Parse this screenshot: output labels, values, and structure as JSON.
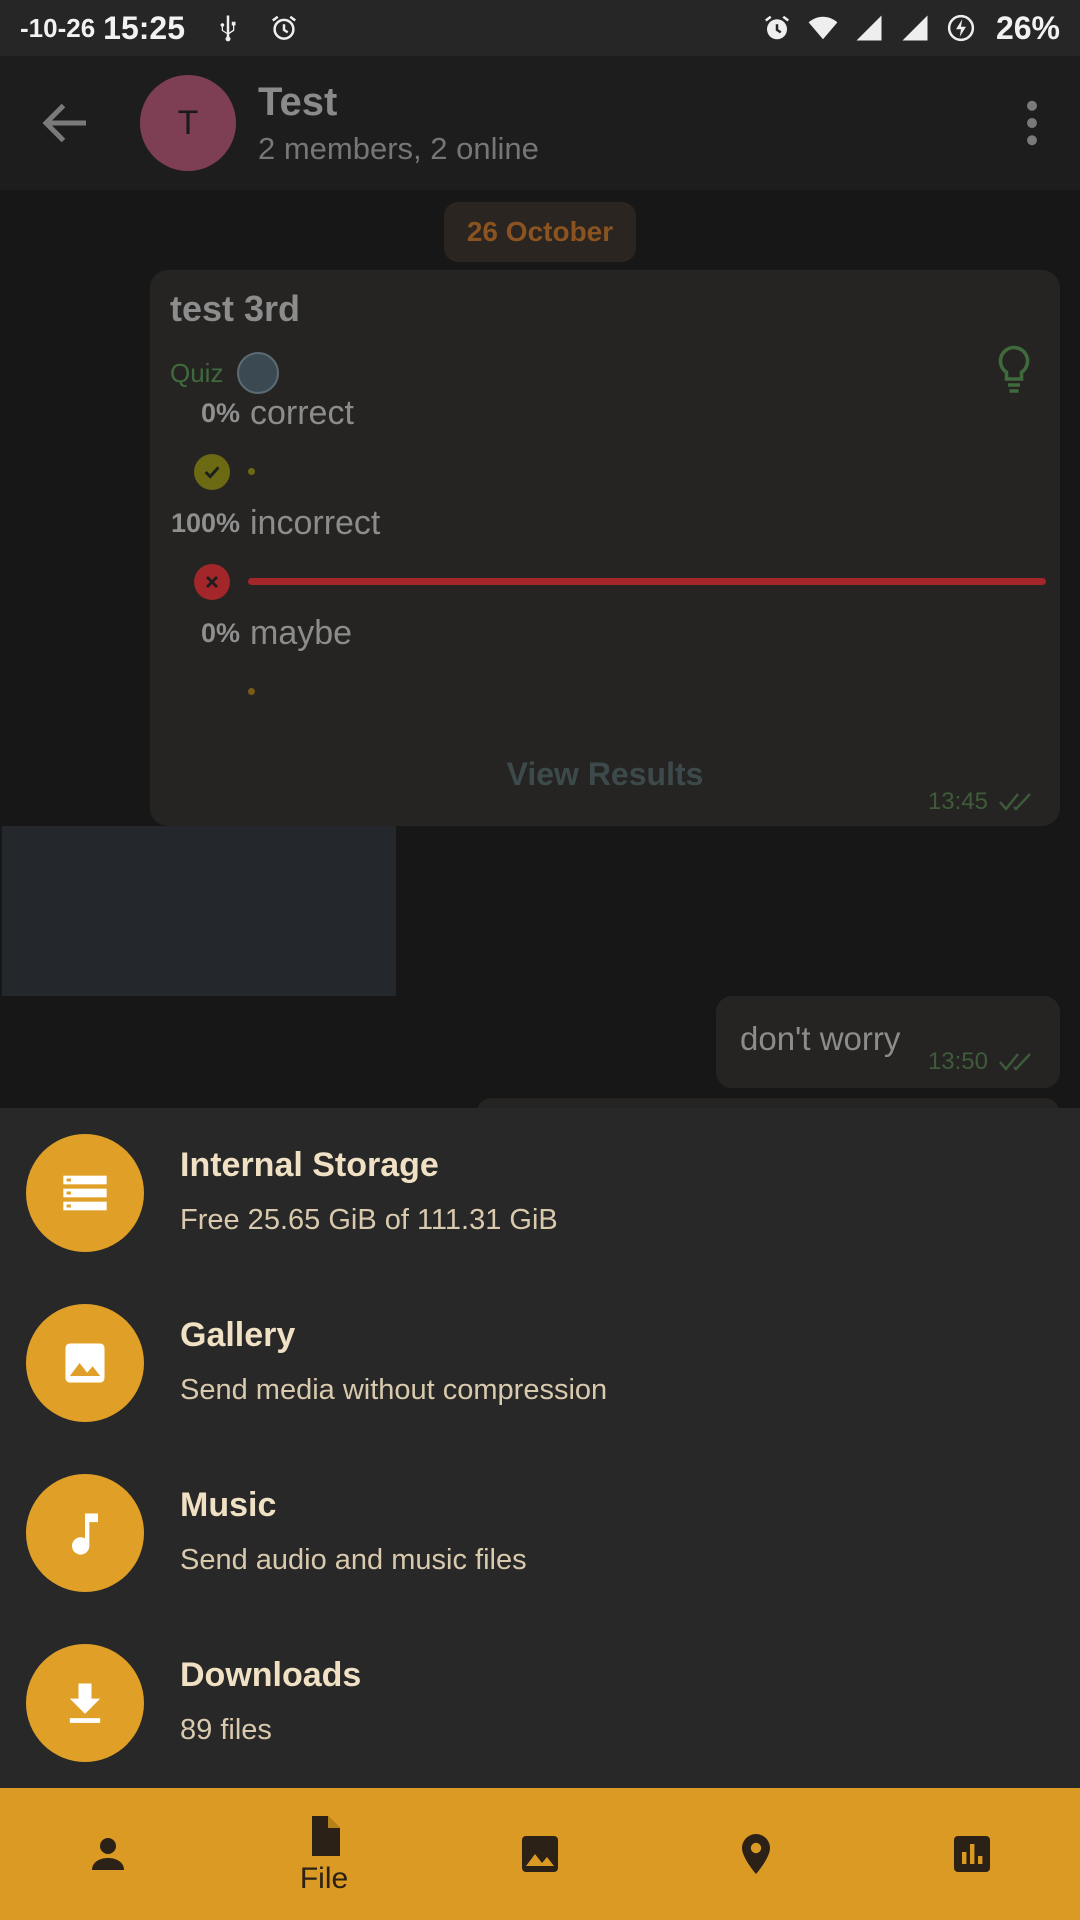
{
  "status_bar": {
    "date": "-10-26",
    "time": "15:25",
    "battery": "26%",
    "icons": [
      "usb-icon",
      "alarm-icon",
      "alarm-icon",
      "wifi-icon",
      "signal-icon",
      "signal-icon",
      "battery-saver-icon"
    ]
  },
  "header": {
    "avatar_letter": "T",
    "title": "Test",
    "subtitle": "2 members, 2 online"
  },
  "chat": {
    "date_pill": "26 October",
    "quiz": {
      "question": "test 3rd",
      "type_label": "Quiz",
      "options": [
        {
          "percent": "0%",
          "text": "correct",
          "result": "correct",
          "fraction": 0.0
        },
        {
          "percent": "100%",
          "text": "incorrect",
          "result": "incorrect",
          "fraction": 1.0
        },
        {
          "percent": "0%",
          "text": "maybe",
          "result": "none",
          "fraction": 0.0
        }
      ],
      "view_results_label": "View Results",
      "time": "13:45"
    },
    "message": {
      "text": "don't worry",
      "time": "13:50"
    }
  },
  "sheet": {
    "items": [
      {
        "title": "Internal Storage",
        "subtitle": "Free 25.65 GiB of 111.31 GiB",
        "icon": "storage-icon"
      },
      {
        "title": "Gallery",
        "subtitle": "Send media without compression",
        "icon": "image-icon"
      },
      {
        "title": "Music",
        "subtitle": "Send audio and music files",
        "icon": "music-note-icon"
      },
      {
        "title": "Downloads",
        "subtitle": "89 files",
        "icon": "download-icon"
      }
    ]
  },
  "bottom_nav": {
    "items": [
      {
        "icon": "contact-icon",
        "label": ""
      },
      {
        "icon": "file-icon",
        "label": "File"
      },
      {
        "icon": "gallery-icon",
        "label": ""
      },
      {
        "icon": "location-icon",
        "label": ""
      },
      {
        "icon": "poll-icon",
        "label": ""
      }
    ]
  },
  "colors": {
    "accent": "#e0a027",
    "nav_background": "#db9a23",
    "sheet_background": "#282828",
    "incorrect_bar": "#a3272a",
    "correct_mark": "#6b6a12"
  }
}
